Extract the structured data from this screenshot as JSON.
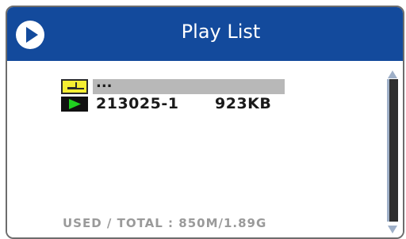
{
  "header": {
    "title": "Play List",
    "play_icon": "play-circle-icon"
  },
  "playlist": {
    "items": [
      {
        "type": "folder",
        "icon": "folder-icon",
        "label": "...",
        "selected": true
      },
      {
        "type": "file",
        "icon": "video-file-icon",
        "name": "213025-1",
        "size": "923KB",
        "selected": false
      }
    ]
  },
  "storage": {
    "usage_text": "USED / TOTAL : 850M/1.89G"
  },
  "colors": {
    "title_bar": "#134a9c",
    "selection_highlight": "#b8b8b8",
    "folder_fill": "#f5ee33",
    "play_green": "#20d020"
  }
}
